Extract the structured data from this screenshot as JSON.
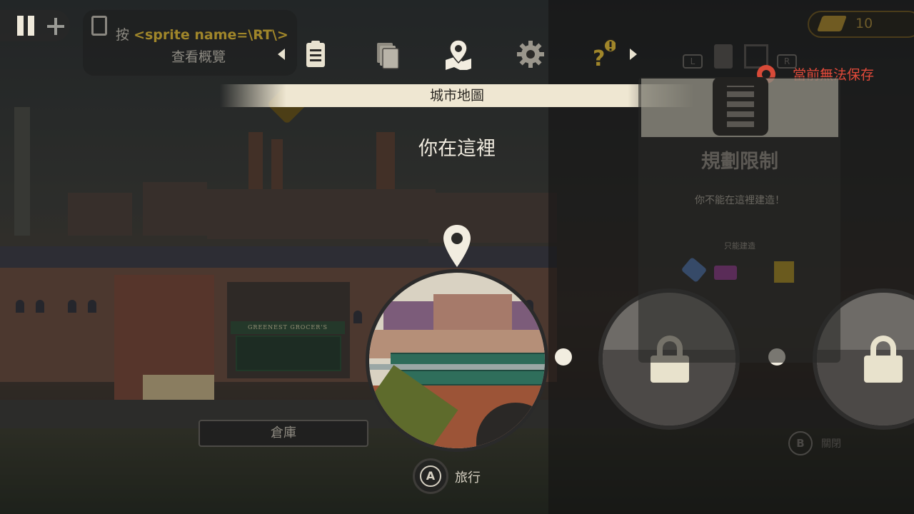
{
  "hud": {
    "hint_press": "按",
    "hint_sprite": "<sprite name=\\RT\\>",
    "hint_action": "查看概覽",
    "coins": "10",
    "save_status": "當前無法保存",
    "shoulder_left": "L",
    "shoulder_right": "R"
  },
  "tabs": [
    {
      "icon": "clipboard-icon",
      "name": "overview"
    },
    {
      "icon": "pages-icon",
      "name": "pages"
    },
    {
      "icon": "map-pin-icon",
      "name": "city-map",
      "active": true
    },
    {
      "icon": "gear-icon",
      "name": "settings"
    },
    {
      "icon": "help-icon",
      "name": "help",
      "alert": true
    }
  ],
  "map": {
    "title": "城市地圖",
    "current_label": "你在這裡",
    "nodes": [
      {
        "state": "current"
      },
      {
        "state": "locked"
      },
      {
        "state": "locked"
      }
    ]
  },
  "scene": {
    "shop_sign": "GREENEST GROCER'S"
  },
  "build_panel": {
    "title": "規劃限制",
    "message": "你不能在這裡建造！",
    "only_label": "只能建造"
  },
  "buttons": {
    "warehouse": "倉庫",
    "a_key": "A",
    "travel": "旅行",
    "b_key": "B",
    "close": "關閉"
  },
  "colors": {
    "banner": "#efe7d2",
    "alert_red": "#e24a3a",
    "gold": "#a0862a"
  }
}
